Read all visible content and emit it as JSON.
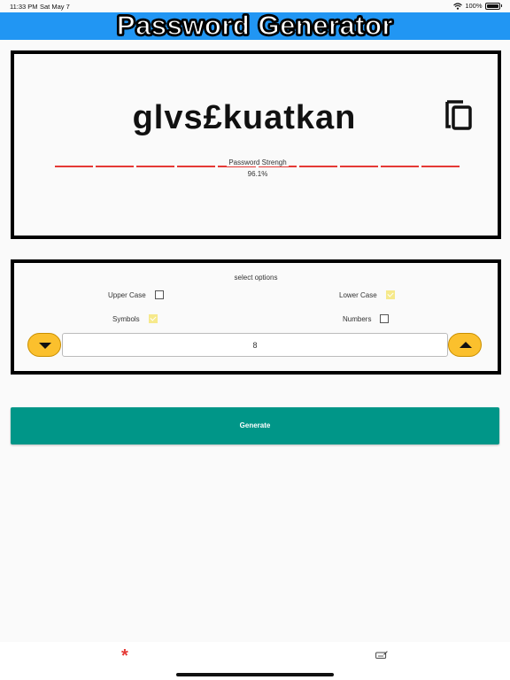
{
  "status_bar": {
    "time": "11:33 PM",
    "date": "Sat May 7",
    "battery": "100%"
  },
  "app_bar": {
    "title": "Password Generator",
    "color": "#2196f3"
  },
  "password_card": {
    "password": "glvs£kuatkan",
    "copy_icon": "copy-icon",
    "strength_label": "Password Strengh",
    "strength_value": "96.1%",
    "strength_color": "#e53935"
  },
  "options": {
    "title": "select options",
    "upper_case": {
      "label": "Upper Case",
      "checked": false
    },
    "lower_case": {
      "label": "Lower Case",
      "checked": true
    },
    "symbols": {
      "label": "Symbols",
      "checked": true
    },
    "numbers": {
      "label": "Numbers",
      "checked": false
    },
    "length_value": "8",
    "decrement_icon": "triangle-down-icon",
    "increment_icon": "triangle-up-icon",
    "stepper_color": "#fbc02d"
  },
  "generate": {
    "label": "Generate",
    "color": "#009688"
  },
  "bottom_nav": {
    "items": [
      {
        "icon": "asterisk-icon",
        "glyph": "*"
      },
      {
        "icon": "password-card-icon"
      }
    ]
  }
}
